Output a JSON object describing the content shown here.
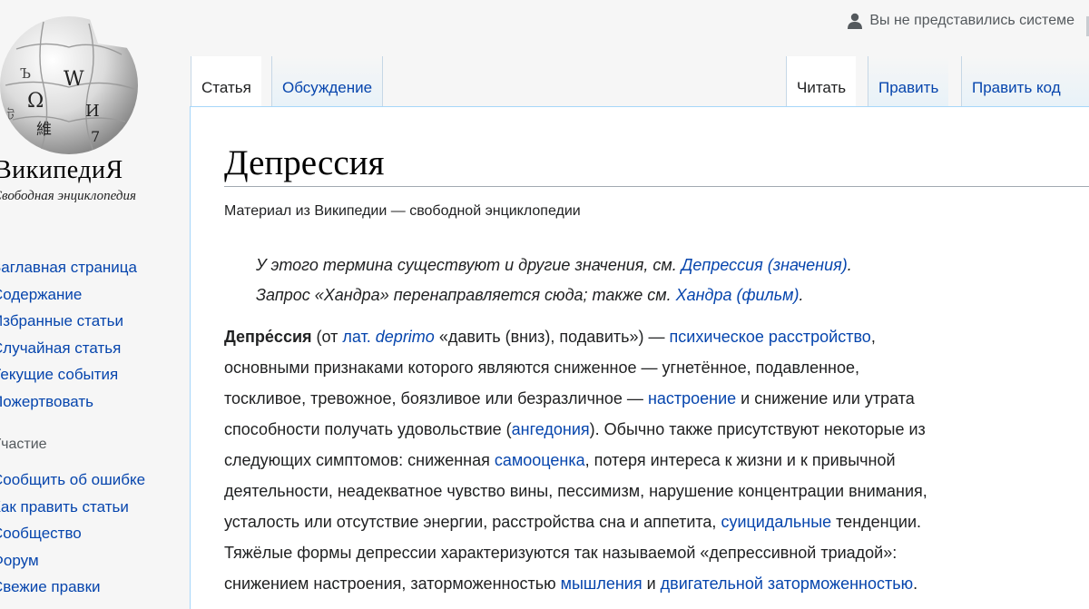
{
  "logo": {
    "wordmark": "ВикипедиЯ",
    "tagline": "Свободная энциклопедия",
    "glyphs": [
      "Ω",
      "W",
      "И",
      "維",
      "Ъ",
      "ট",
      "7"
    ]
  },
  "sidebar": {
    "main_nav": [
      {
        "label": "Заглавная страница"
      },
      {
        "label": "Содержание"
      },
      {
        "label": "Избранные статьи"
      },
      {
        "label": "Случайная статья"
      },
      {
        "label": "Текущие события"
      },
      {
        "label": "Пожертвовать"
      }
    ],
    "participation_heading": "Участие",
    "participation_nav": [
      {
        "label": "Сообщить об ошибке"
      },
      {
        "label": "Как править статьи"
      },
      {
        "label": "Сообщество"
      },
      {
        "label": "Форум"
      },
      {
        "label": "Свежие правки"
      }
    ]
  },
  "userbar": {
    "icon": "user-icon",
    "text": "Вы не представились системе"
  },
  "tabs": {
    "left": [
      {
        "label": "Статья",
        "selected": true
      },
      {
        "label": "Обсуждение",
        "selected": false
      }
    ],
    "right": [
      {
        "label": "Читать",
        "selected": true
      },
      {
        "label": "Править",
        "selected": false
      },
      {
        "label": "Править код",
        "selected": false
      }
    ]
  },
  "article": {
    "title": "Депрессия",
    "site_sub": "Материал из Википедии — свободной энциклопедии",
    "hatnote1": {
      "text": "У этого термина существуют и другие значения, см. ",
      "link": "Депрессия (значения)",
      "end": "."
    },
    "hatnote2": {
      "text": "Запрос «Хандра» перенаправляется сюда; также см. ",
      "link": "Хандра (фильм)",
      "end": "."
    },
    "lead": {
      "term": "Депре́ссия",
      "t1": " (от ",
      "lang_link": "лат.",
      "t2": " ",
      "latin_link": "deprimo",
      "t3": " «давить (вниз), подавить») — ",
      "link1": "психическое расстройство",
      "t4": ",",
      "t5": "основными признаками которого являются сниженное — угнетённое, подавленное,",
      "t6": "тоскливое, тревожное, боязливое или безразличное — ",
      "link2": "настроение",
      "t7": " и снижение или утрата",
      "t8": "способности получать удовольствие (",
      "link3": "ангедония",
      "t9": "). Обычно также присутствуют некоторые из",
      "t10": "следующих симптомов: сниженная ",
      "link4": "самооценка",
      "t11": ", потеря интереса к жизни и к привычной",
      "t12": "деятельности, неадекватное чувство вины, пессимизм, нарушение концентрации внимания,",
      "t13": "усталость или отсутствие энергии, расстройства сна и аппетита, ",
      "link5": "суицидальные",
      "t14": " тенденции.",
      "t15": "Тяжёлые формы депрессии характеризуются так называемой «депрессивной триадой»:",
      "t16": "снижением настроения, заторможенностью ",
      "link6": "мышления",
      "t17": " и ",
      "link7": "двигательной заторможенностью",
      "t18": "."
    }
  },
  "colors": {
    "link": "#0645ad",
    "background": "#f6f6f6",
    "content_border": "#a7d7f9",
    "text": "#202122"
  }
}
